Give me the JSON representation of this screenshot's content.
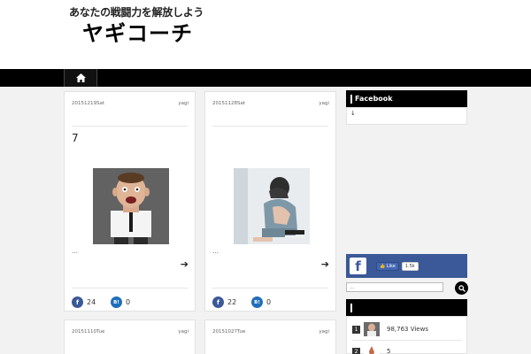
{
  "header": {
    "tagline": "あなたの戦闘力を解放しよう",
    "site_title": "ヤギコーチ"
  },
  "nav": {
    "home_icon": "home-icon"
  },
  "posts": [
    {
      "date": "20151219Sat",
      "author": "yagi",
      "title": "7",
      "excerpt": "…",
      "facebook_count": "24",
      "hatena_count": "0",
      "hatena_label": "B!"
    },
    {
      "date": "20151128Sat",
      "author": "yagi",
      "title": "",
      "excerpt": "…",
      "facebook_count": "22",
      "hatena_count": "0",
      "hatena_label": "B!"
    },
    {
      "date": "20151110Tue",
      "author": "yagi"
    },
    {
      "date": "20151027Tue",
      "author": "yagi"
    }
  ],
  "sidebar": {
    "facebook_widget_title": "Facebook",
    "facebook_widget_body": "↓",
    "fb_like_label": "Like",
    "fb_like_count": "1.5k",
    "search_placeholder": "...",
    "ranking_title": "",
    "ranking": [
      {
        "rank": "1",
        "text": "98,763 Views"
      },
      {
        "rank": "2",
        "text": "5"
      }
    ]
  },
  "colors": {
    "nav_bg": "#000000",
    "facebook_blue": "#3b5998",
    "hatena_blue": "#1e6fba",
    "page_bg": "#f2f2f2"
  }
}
